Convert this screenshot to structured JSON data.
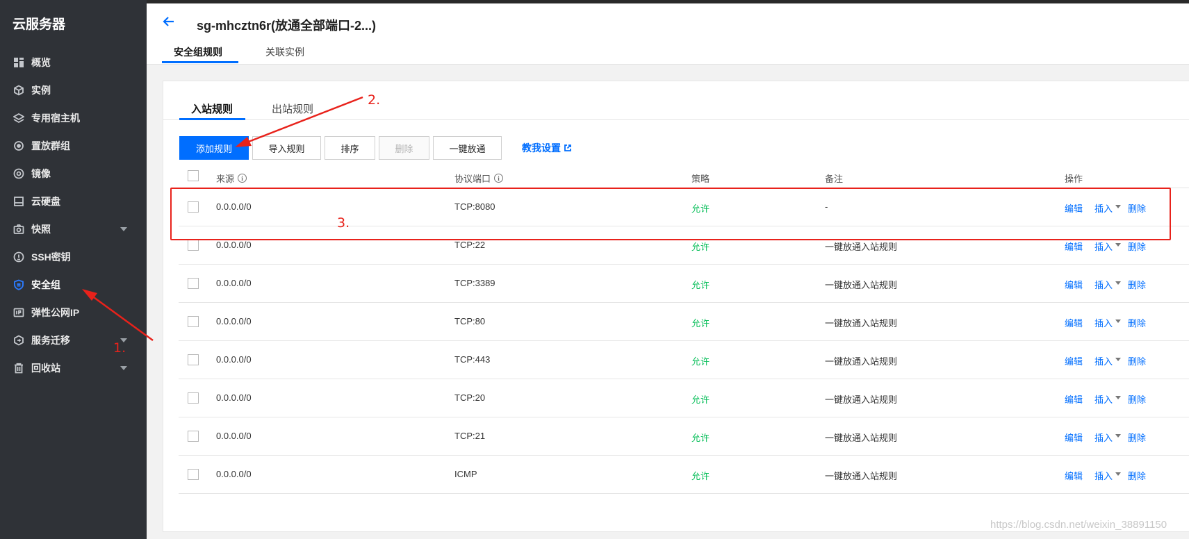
{
  "sidebar": {
    "title": "云服务器",
    "items": [
      {
        "label": "概览",
        "icon": "grid-icon"
      },
      {
        "label": "实例",
        "icon": "cube-icon"
      },
      {
        "label": "专用宿主机",
        "icon": "layers-icon"
      },
      {
        "label": "置放群组",
        "icon": "cluster-icon"
      },
      {
        "label": "镜像",
        "icon": "disc-icon"
      },
      {
        "label": "云硬盘",
        "icon": "disk-icon"
      },
      {
        "label": "快照",
        "icon": "camera-icon"
      },
      {
        "label": "SSH密钥",
        "icon": "key-icon"
      },
      {
        "label": "安全组",
        "icon": "shield-icon"
      },
      {
        "label": "弹性公网IP",
        "icon": "ip-icon"
      },
      {
        "label": "服务迁移",
        "icon": "migrate-icon"
      },
      {
        "label": "回收站",
        "icon": "trash-icon"
      }
    ]
  },
  "header": {
    "title": "sg-mhcztn6r(放通全部端口-2...)",
    "tabs": [
      "安全组规则",
      "关联实例"
    ]
  },
  "rules": {
    "subtabs": [
      "入站规则",
      "出站规则"
    ],
    "buttons": {
      "add": "添加规则",
      "import": "导入规则",
      "sort": "排序",
      "delete": "删除",
      "open_all": "一键放通"
    },
    "help_link": "教我设置",
    "columns": {
      "source": "来源",
      "port": "协议端口",
      "policy": "策略",
      "remark": "备注",
      "ops": "操作"
    },
    "op_labels": {
      "edit": "编辑",
      "insert": "插入",
      "delete": "删除"
    },
    "rows": [
      {
        "source": "0.0.0.0/0",
        "port": "TCP:8080",
        "policy": "允许",
        "remark": "-"
      },
      {
        "source": "0.0.0.0/0",
        "port": "TCP:22",
        "policy": "允许",
        "remark": "一键放通入站规则"
      },
      {
        "source": "0.0.0.0/0",
        "port": "TCP:3389",
        "policy": "允许",
        "remark": "一键放通入站规则"
      },
      {
        "source": "0.0.0.0/0",
        "port": "TCP:80",
        "policy": "允许",
        "remark": "一键放通入站规则"
      },
      {
        "source": "0.0.0.0/0",
        "port": "TCP:443",
        "policy": "允许",
        "remark": "一键放通入站规则"
      },
      {
        "source": "0.0.0.0/0",
        "port": "TCP:20",
        "policy": "允许",
        "remark": "一键放通入站规则"
      },
      {
        "source": "0.0.0.0/0",
        "port": "TCP:21",
        "policy": "允许",
        "remark": "一键放通入站规则"
      },
      {
        "source": "0.0.0.0/0",
        "port": "ICMP",
        "policy": "允许",
        "remark": "一键放通入站规则"
      }
    ]
  },
  "annotations": {
    "step1": "1.",
    "step2": "2.",
    "step3": "3."
  },
  "watermark": "https://blog.csdn.net/weixin_38891150",
  "colors": {
    "primary": "#006eff",
    "allow": "#0abf5b",
    "annotation": "#e8221b",
    "sidebar_bg": "#2f3237"
  }
}
